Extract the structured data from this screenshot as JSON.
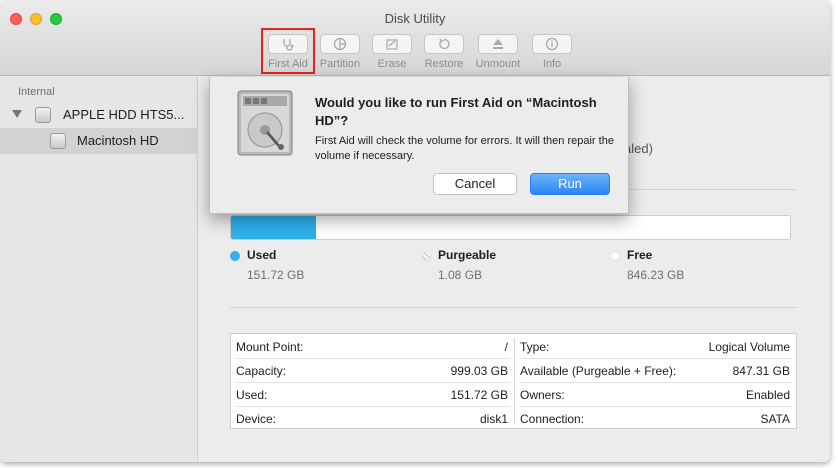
{
  "window": {
    "title": "Disk Utility"
  },
  "toolbar": {
    "items": [
      {
        "label": "First Aid",
        "icon": "stethoscope-icon",
        "highlighted": true
      },
      {
        "label": "Partition",
        "icon": "partition-icon"
      },
      {
        "label": "Erase",
        "icon": "erase-icon"
      },
      {
        "label": "Restore",
        "icon": "restore-icon"
      },
      {
        "label": "Unmount",
        "icon": "eject-icon"
      },
      {
        "label": "Info",
        "icon": "info-icon"
      }
    ],
    "highlight_color": "#e0261f"
  },
  "sidebar": {
    "section_header": "Internal",
    "disk_label": "APPLE HDD HTS5...",
    "volume_label": "Macintosh HD"
  },
  "main": {
    "partial_text": "aled)",
    "usage": {
      "used_fraction": 0.1519,
      "used_color": "#2fb1ea",
      "legend": [
        {
          "name": "Used",
          "value": "151.72 GB",
          "color": "#2fb1ea"
        },
        {
          "name": "Purgeable",
          "value": "1.08 GB",
          "color": "#ffffff"
        },
        {
          "name": "Free",
          "value": "846.23 GB",
          "color": "#ffffff"
        }
      ]
    },
    "info": {
      "left": [
        {
          "key": "Mount Point:",
          "value": "/"
        },
        {
          "key": "Capacity:",
          "value": "999.03 GB"
        },
        {
          "key": "Used:",
          "value": "151.72 GB"
        },
        {
          "key": "Device:",
          "value": "disk1"
        }
      ],
      "right": [
        {
          "key": "Type:",
          "value": "Logical Volume"
        },
        {
          "key": "Available (Purgeable + Free):",
          "value": "847.31 GB"
        },
        {
          "key": "Owners:",
          "value": "Enabled"
        },
        {
          "key": "Connection:",
          "value": "SATA"
        }
      ]
    }
  },
  "dialog": {
    "title": "Would you like to run First Aid on “Macintosh HD”?",
    "message": "First Aid will check the volume for errors. It will then repair the volume if necessary.",
    "cancel_label": "Cancel",
    "run_label": "Run",
    "icon": "hard-drive-icon"
  }
}
